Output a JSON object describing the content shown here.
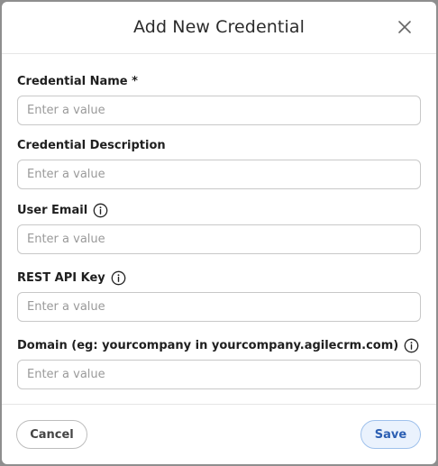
{
  "dialog": {
    "title": "Add New Credential",
    "close_icon": "close-icon"
  },
  "fields": [
    {
      "label": "Credential Name *",
      "placeholder": "Enter a value",
      "value": "",
      "has_info": false
    },
    {
      "label": "Credential Description",
      "placeholder": "Enter a value",
      "value": "",
      "has_info": false
    },
    {
      "label": "User Email",
      "placeholder": "Enter a value",
      "value": "",
      "has_info": true
    },
    {
      "label": "REST API Key",
      "placeholder": "Enter a value",
      "value": "",
      "has_info": true
    },
    {
      "label": "Domain (eg: yourcompany in yourcompany.agilecrm.com)",
      "placeholder": "Enter a value",
      "value": "",
      "has_info": true
    }
  ],
  "footer": {
    "cancel_label": "Cancel",
    "save_label": "Save"
  },
  "colors": {
    "save_bg": "#eaf2fd",
    "save_text": "#2c5fb3",
    "save_border": "#9fc1ec"
  }
}
